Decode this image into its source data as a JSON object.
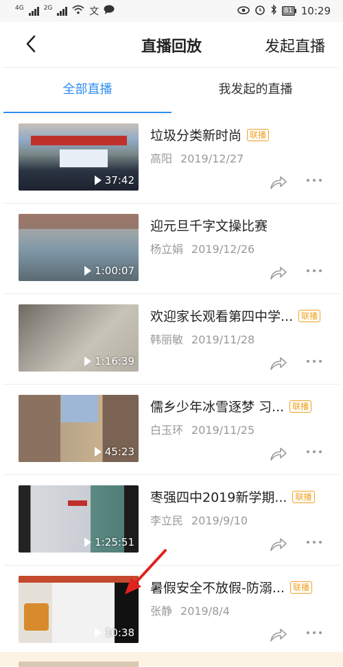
{
  "status": {
    "left_signal_1": "4G",
    "left_signal_2": "2G",
    "battery": "81",
    "time": "10:29"
  },
  "nav": {
    "title": "直播回放",
    "start_live": "发起直播"
  },
  "tabs": [
    "全部直播",
    "我发起的直播"
  ],
  "items": [
    {
      "title": "垃圾分类新时尚",
      "badge": "联播",
      "author": "高阳",
      "date": "2019/12/27",
      "duration": "37:42"
    },
    {
      "title": "迎元旦千字文操比赛",
      "badge": "",
      "author": "杨立娟",
      "date": "2019/12/26",
      "duration": "1:00:07"
    },
    {
      "title": "欢迎家长观看第四中学...",
      "badge": "联播",
      "author": "韩丽敏",
      "date": "2019/11/28",
      "duration": "1:16:39"
    },
    {
      "title": "儒乡少年冰雪逐梦 习...",
      "badge": "联播",
      "author": "白玉环",
      "date": "2019/11/25",
      "duration": "45:23"
    },
    {
      "title": "枣强四中2019新学期...",
      "badge": "联播",
      "author": "李立民",
      "date": "2019/9/10",
      "duration": "1:25:51"
    },
    {
      "title": "暑假安全不放假-防溺...",
      "badge": "联播",
      "author": "张静",
      "date": "2019/8/4",
      "duration": "10:38"
    }
  ],
  "colors": {
    "accent": "#2f8ef2",
    "badge": "#f0a020",
    "annotation_arrow": "#e0231e"
  }
}
